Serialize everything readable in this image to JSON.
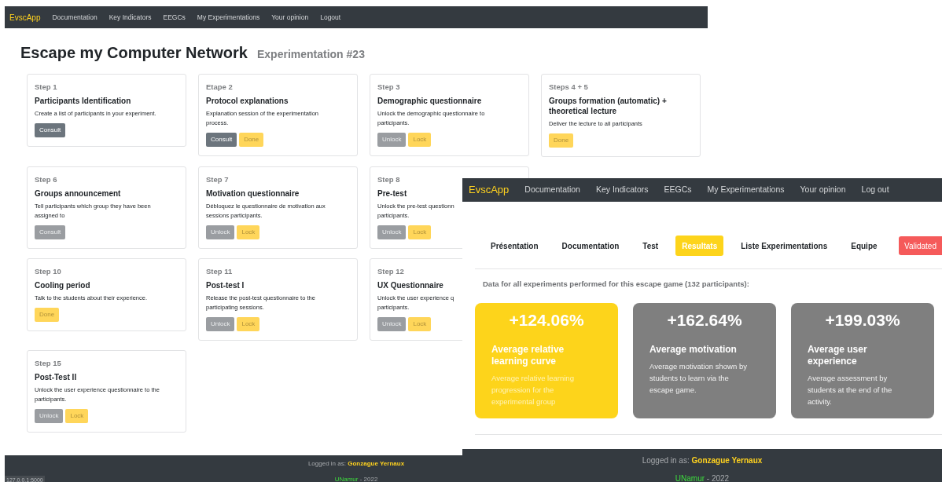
{
  "main_window": {
    "navbar": {
      "brand": "EvscApp",
      "links": [
        "Documentation",
        "Key Indicators",
        "EEGCs",
        "My Experimentations",
        "Your opinion",
        "Logout"
      ]
    },
    "title": "Escape my Computer Network",
    "subtitle": "Experimentation #23",
    "step_rows": [
      [
        {
          "step": "Step 1",
          "title": [
            "Participants Identification"
          ],
          "description": [
            "Create a list of participants in your experiment."
          ],
          "buttons": [
            {
              "label": "Consult",
              "kind": "secondary",
              "disabled": false
            }
          ]
        },
        {
          "step": "Etape 2",
          "title": [
            "Protocol explanations"
          ],
          "description": [
            "Explanation session of the experimentation",
            "process."
          ],
          "buttons": [
            {
              "label": "Consult",
              "kind": "secondary",
              "disabled": false
            },
            {
              "label": "Done",
              "kind": "warning",
              "disabled": true
            }
          ]
        },
        {
          "step": "Step 3",
          "title": [
            "Demographic questionnaire"
          ],
          "description": [
            "Unlock the demographic questionnaire to",
            "participants."
          ],
          "buttons": [
            {
              "label": "Unlock",
              "kind": "secondary",
              "disabled": true
            },
            {
              "label": "Lock",
              "kind": "warning",
              "disabled": true
            }
          ]
        },
        {
          "step": "Steps 4 + 5",
          "title": [
            "Groups formation (automatic) +",
            "theoretical lecture"
          ],
          "description": [
            "Deliver the lecture to all participants"
          ],
          "buttons": [
            {
              "label": "Done",
              "kind": "warning",
              "disabled": true
            }
          ]
        }
      ],
      [
        {
          "step": "Step 6",
          "title": [
            "Groups announcement"
          ],
          "description": [
            "Tell participants which group they have been",
            "assigned to"
          ],
          "buttons": [
            {
              "label": "Consult",
              "kind": "secondary",
              "disabled": true
            }
          ]
        },
        {
          "step": "Step 7",
          "title": [
            "Motivation questionnaire"
          ],
          "description": [
            "Débloquez le questionnaire de motivation aux",
            "sessions participants."
          ],
          "buttons": [
            {
              "label": "Unlock",
              "kind": "secondary",
              "disabled": true
            },
            {
              "label": "Lock",
              "kind": "warning",
              "disabled": true
            }
          ]
        },
        {
          "step": "Step 8",
          "title": [
            "Pre-test"
          ],
          "description": [
            "Unlock the pre-test questionn",
            "participants."
          ],
          "buttons": [
            {
              "label": "Unlock",
              "kind": "secondary",
              "disabled": true
            },
            {
              "label": "Lock",
              "kind": "warning",
              "disabled": true
            }
          ]
        }
      ],
      [
        {
          "step": "Step 10",
          "title": [
            "Cooling period"
          ],
          "description": [
            "Talk to the students about their experience."
          ],
          "buttons": [
            {
              "label": "Done",
              "kind": "warning",
              "disabled": true
            }
          ]
        },
        {
          "step": "Step 11",
          "title": [
            "Post-test I"
          ],
          "description": [
            "Release the post-test questionnaire to the",
            "participating sessions."
          ],
          "buttons": [
            {
              "label": "Unlock",
              "kind": "secondary",
              "disabled": true
            },
            {
              "label": "Lock",
              "kind": "warning",
              "disabled": true
            }
          ]
        },
        {
          "step": "Step 12",
          "title": [
            "UX Questionnaire"
          ],
          "description": [
            "Unlock the user experience q",
            "participants."
          ],
          "buttons": [
            {
              "label": "Unlock",
              "kind": "secondary",
              "disabled": true
            },
            {
              "label": "Lock",
              "kind": "warning",
              "disabled": true
            }
          ]
        }
      ],
      [
        {
          "step": "Step 15",
          "title": [
            "Post-Test II"
          ],
          "description": [
            "Unlock the user experience questionnaire to the",
            "participants."
          ],
          "buttons": [
            {
              "label": "Unlock",
              "kind": "secondary",
              "disabled": true
            },
            {
              "label": "Lock",
              "kind": "warning",
              "disabled": true
            }
          ]
        }
      ]
    ],
    "footer": {
      "label": "Logged in as:",
      "user": "Gonzague Yernaux",
      "org": "UNamur",
      "year": "- 2022"
    },
    "status_url": "127.0.0.1:5000"
  },
  "results_window": {
    "navbar": {
      "brand": "EvscApp",
      "links": [
        "Documentation",
        "Key Indicators",
        "EEGCs",
        "My Experimentations",
        "Your opinion",
        "Log out"
      ]
    },
    "tabs": [
      {
        "label": "Présentation",
        "selected": false
      },
      {
        "label": "Documentation",
        "selected": false
      },
      {
        "label": "Test",
        "selected": false
      },
      {
        "label": "Resultats",
        "selected": true
      },
      {
        "label": "Liste Experimentations",
        "selected": false
      },
      {
        "label": "Equipe",
        "selected": false
      }
    ],
    "status_badge": "Validated",
    "summary": "Data for all experiments performed for this escape game (132 participants):",
    "stats": [
      {
        "value": "+124.06%",
        "title": [
          "Average relative",
          "learning curve"
        ],
        "description": [
          "Average relative learning",
          "progression for the",
          "experimental group"
        ],
        "highlighted": true
      },
      {
        "value": "+162.64%",
        "title": [
          "Average motivation"
        ],
        "description": [
          "Average motivation shown by",
          "students to learn via the",
          "escape game."
        ],
        "highlighted": false
      },
      {
        "value": "+199.03%",
        "title": [
          "Average user",
          "experience"
        ],
        "description": [
          "Average assessment by",
          "students at the end of the",
          "activity."
        ],
        "highlighted": false
      }
    ],
    "footer": {
      "label": "Logged in as:",
      "user": "Gonzague Yernaux",
      "org": "UNamur",
      "year": "- 2022"
    }
  }
}
